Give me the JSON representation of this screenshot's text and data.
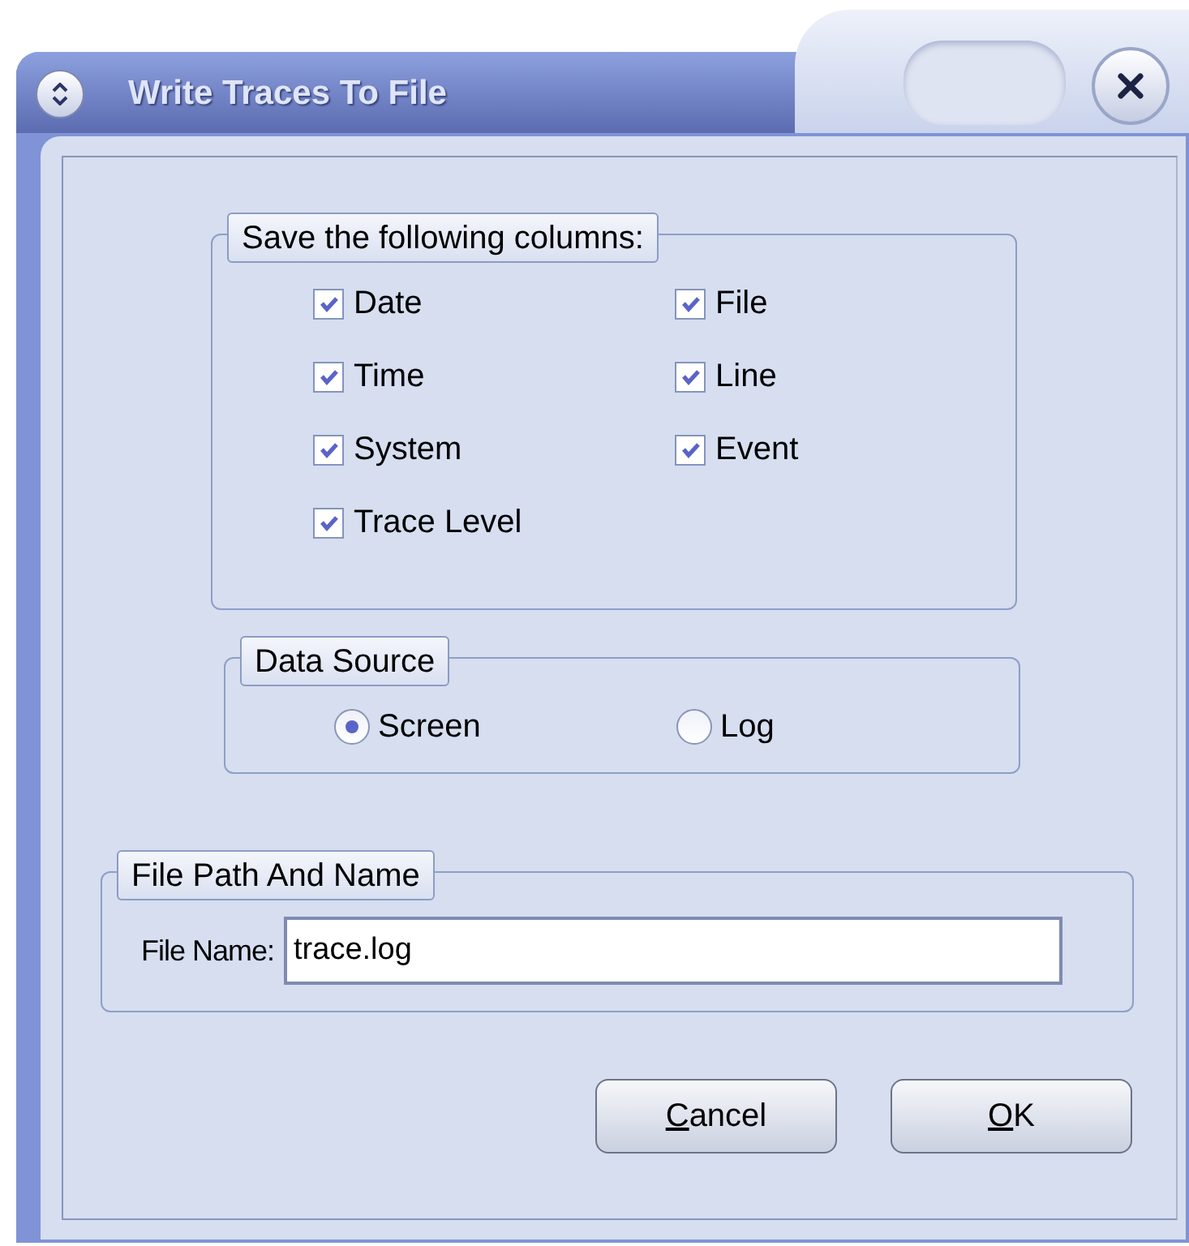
{
  "window": {
    "title": "Write Traces To File"
  },
  "columns_group": {
    "legend": "Save the following columns:",
    "items": [
      {
        "label": "Date",
        "checked": true
      },
      {
        "label": "File",
        "checked": true
      },
      {
        "label": "Time",
        "checked": true
      },
      {
        "label": "Line",
        "checked": true
      },
      {
        "label": "System",
        "checked": true
      },
      {
        "label": "Event",
        "checked": true
      },
      {
        "label": "Trace Level",
        "checked": true
      }
    ]
  },
  "data_source": {
    "legend": "Data Source",
    "options": [
      {
        "label": "Screen",
        "selected": true
      },
      {
        "label": "Log",
        "selected": false
      }
    ]
  },
  "file_group": {
    "legend": "File Path And Name",
    "label": "File Name:",
    "value": "trace.log"
  },
  "buttons": [
    {
      "label": "Cancel",
      "first_letter_underlined": true
    },
    {
      "label": "OK",
      "first_letter_underlined": true
    }
  ]
}
